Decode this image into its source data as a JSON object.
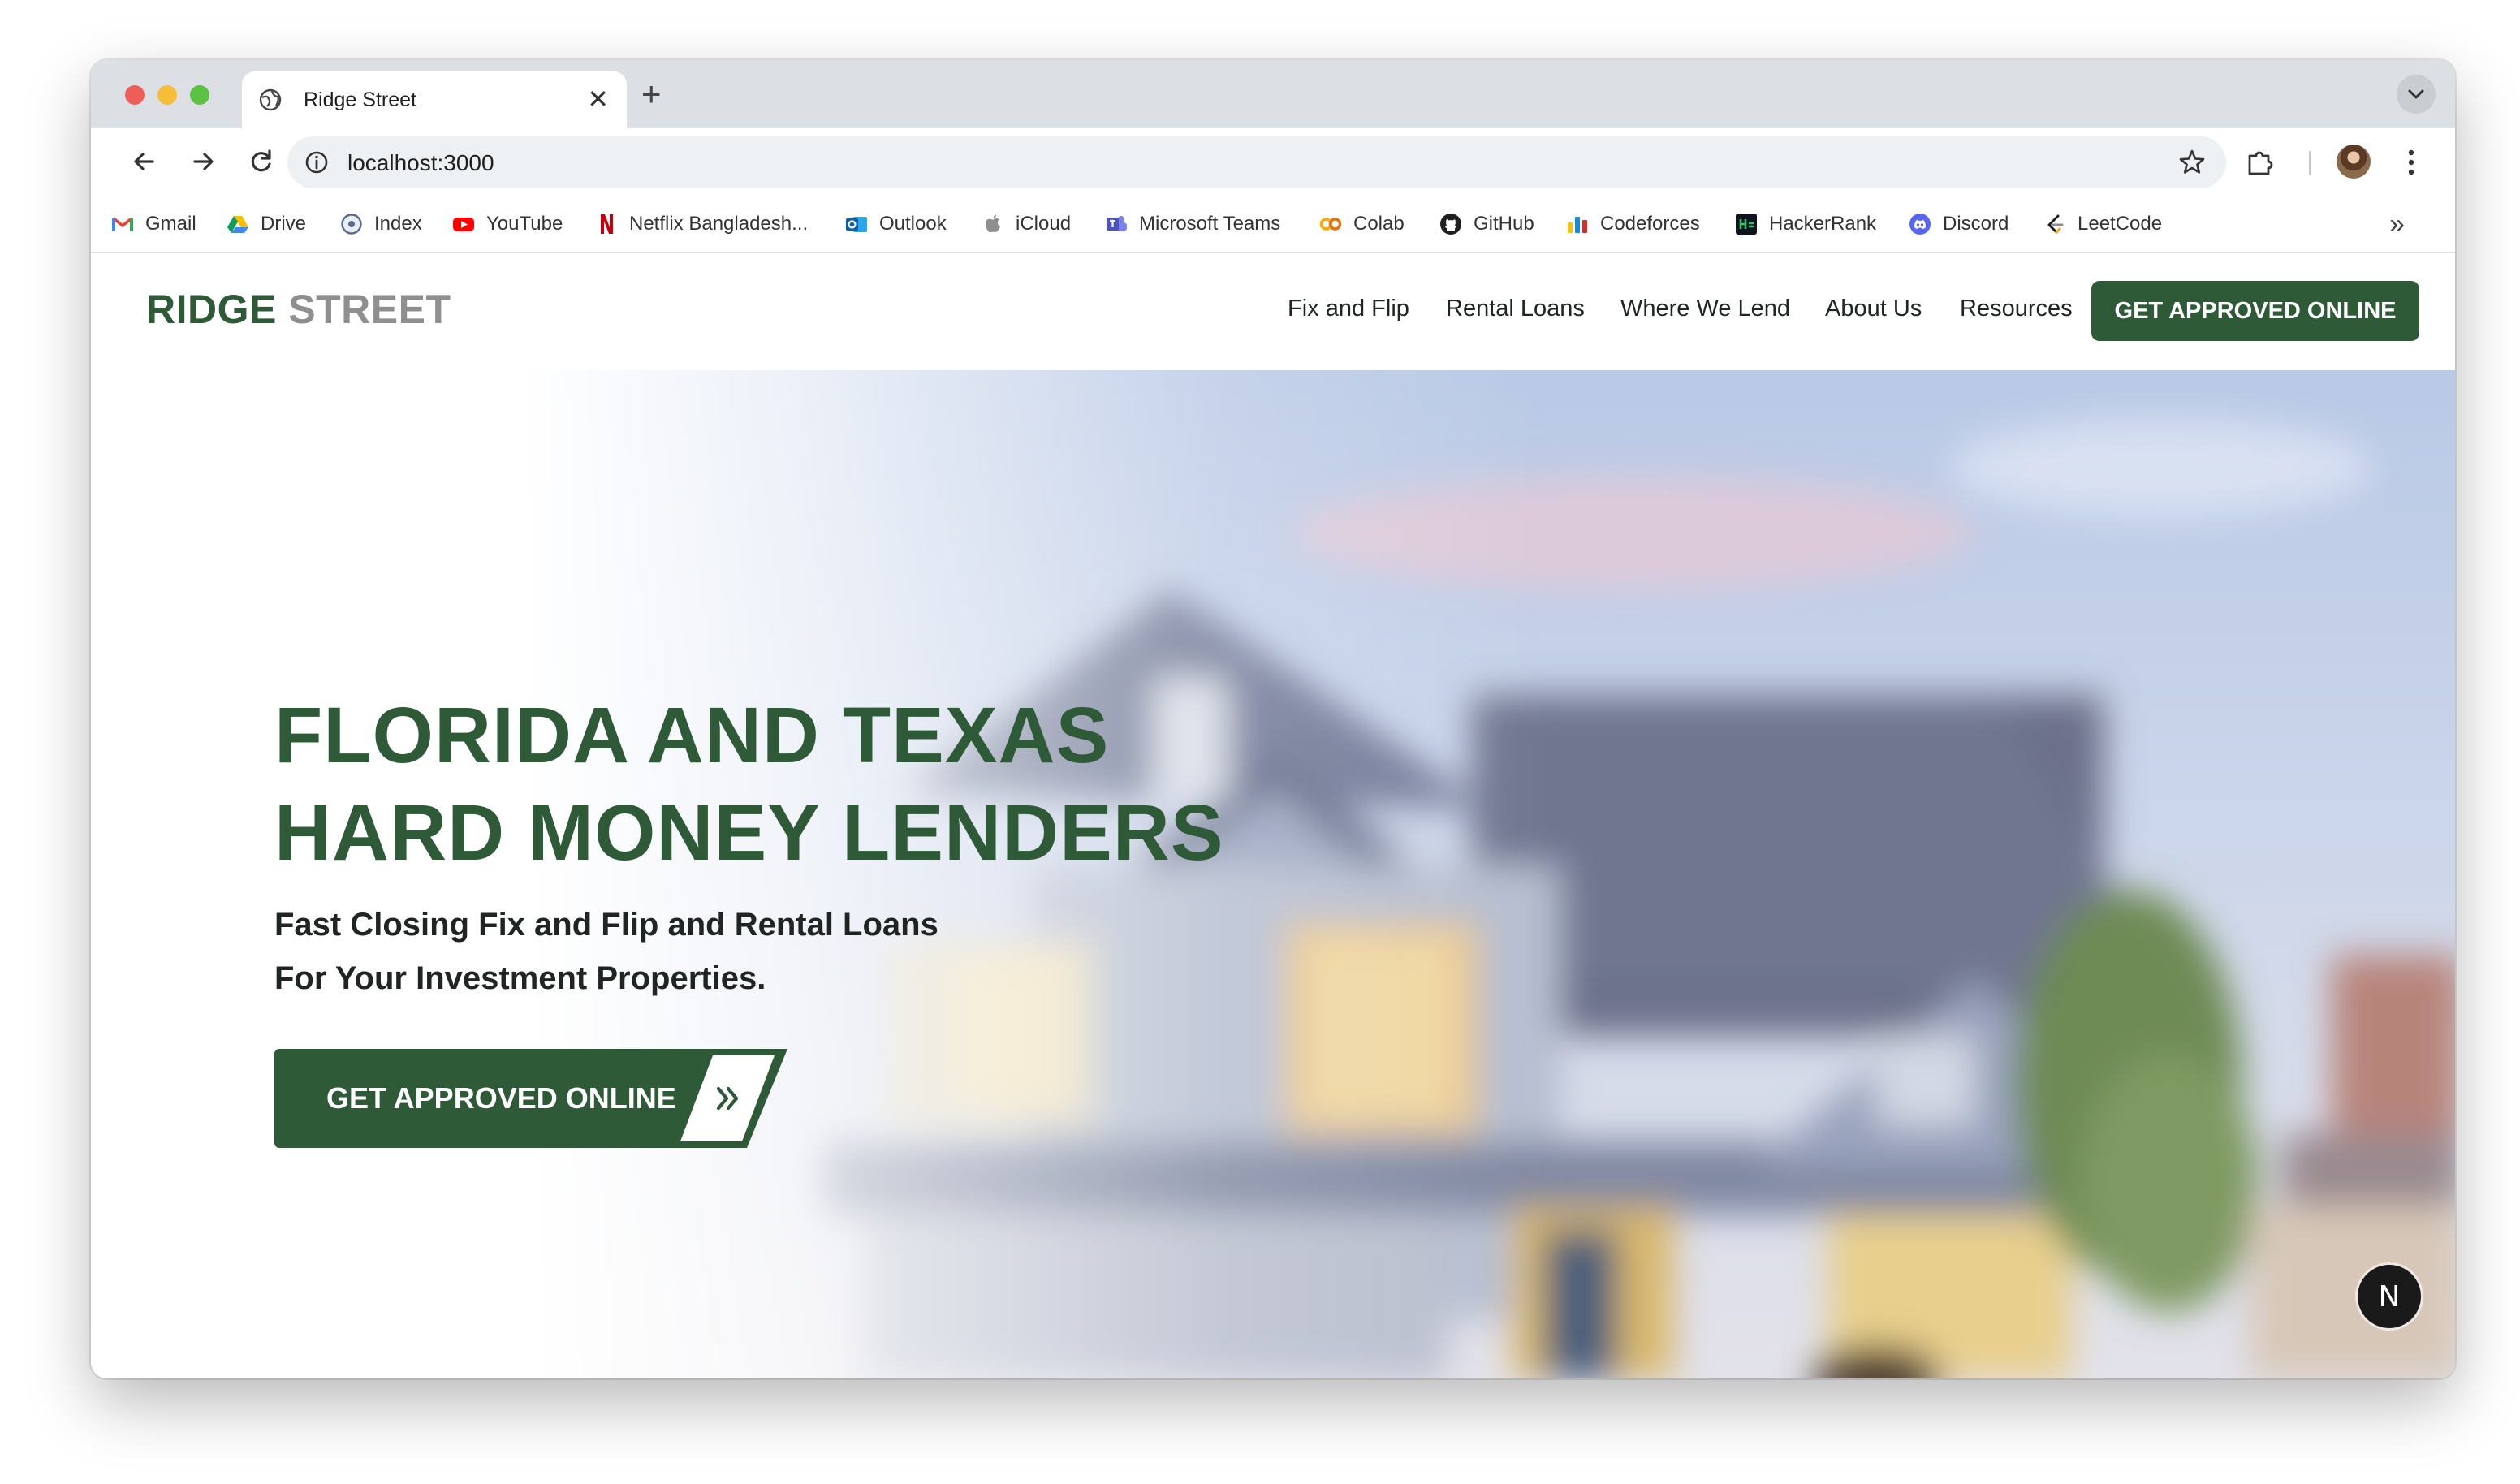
{
  "browser": {
    "tab": {
      "title": "Ridge Street",
      "close_glyph": "✕",
      "new_tab_glyph": "+"
    },
    "address_bar": {
      "url": "localhost:3000"
    },
    "bookmarks": [
      {
        "label": "Gmail",
        "icon": "gmail-icon"
      },
      {
        "label": "Drive",
        "icon": "drive-icon"
      },
      {
        "label": "Index",
        "icon": "index-icon"
      },
      {
        "label": "YouTube",
        "icon": "youtube-icon"
      },
      {
        "label": "Netflix Bangladesh...",
        "icon": "netflix-icon"
      },
      {
        "label": "Outlook",
        "icon": "outlook-icon"
      },
      {
        "label": "iCloud",
        "icon": "apple-icon"
      },
      {
        "label": "Microsoft Teams",
        "icon": "teams-icon"
      },
      {
        "label": "Colab",
        "icon": "colab-icon"
      },
      {
        "label": "GitHub",
        "icon": "github-icon"
      },
      {
        "label": "Codeforces",
        "icon": "codeforces-icon"
      },
      {
        "label": "HackerRank",
        "icon": "hackerrank-icon"
      },
      {
        "label": "Discord",
        "icon": "discord-icon"
      },
      {
        "label": "LeetCode",
        "icon": "leetcode-icon"
      }
    ],
    "bookmarks_overflow_glyph": "»"
  },
  "site": {
    "logo": {
      "primary": "RIDGE",
      "secondary": "STREET"
    },
    "nav": [
      {
        "label": "Fix and Flip"
      },
      {
        "label": "Rental Loans"
      },
      {
        "label": "Where We Lend"
      },
      {
        "label": "About Us"
      },
      {
        "label": "Resources"
      }
    ],
    "nav_cta": "GET APPROVED ONLINE",
    "hero": {
      "title_line1": "FLORIDA AND TEXAS",
      "title_line2": "HARD MONEY LENDERS",
      "subtitle_line1": "Fast Closing Fix and Flip and Rental Loans",
      "subtitle_line2": "For Your Investment Properties.",
      "cta": "GET APPROVED ONLINE"
    },
    "dev_badge": "N"
  },
  "colors": {
    "brand_green": "#2f5a38",
    "logo_gray": "#8f8f8f",
    "text_dark": "#1f2522"
  }
}
